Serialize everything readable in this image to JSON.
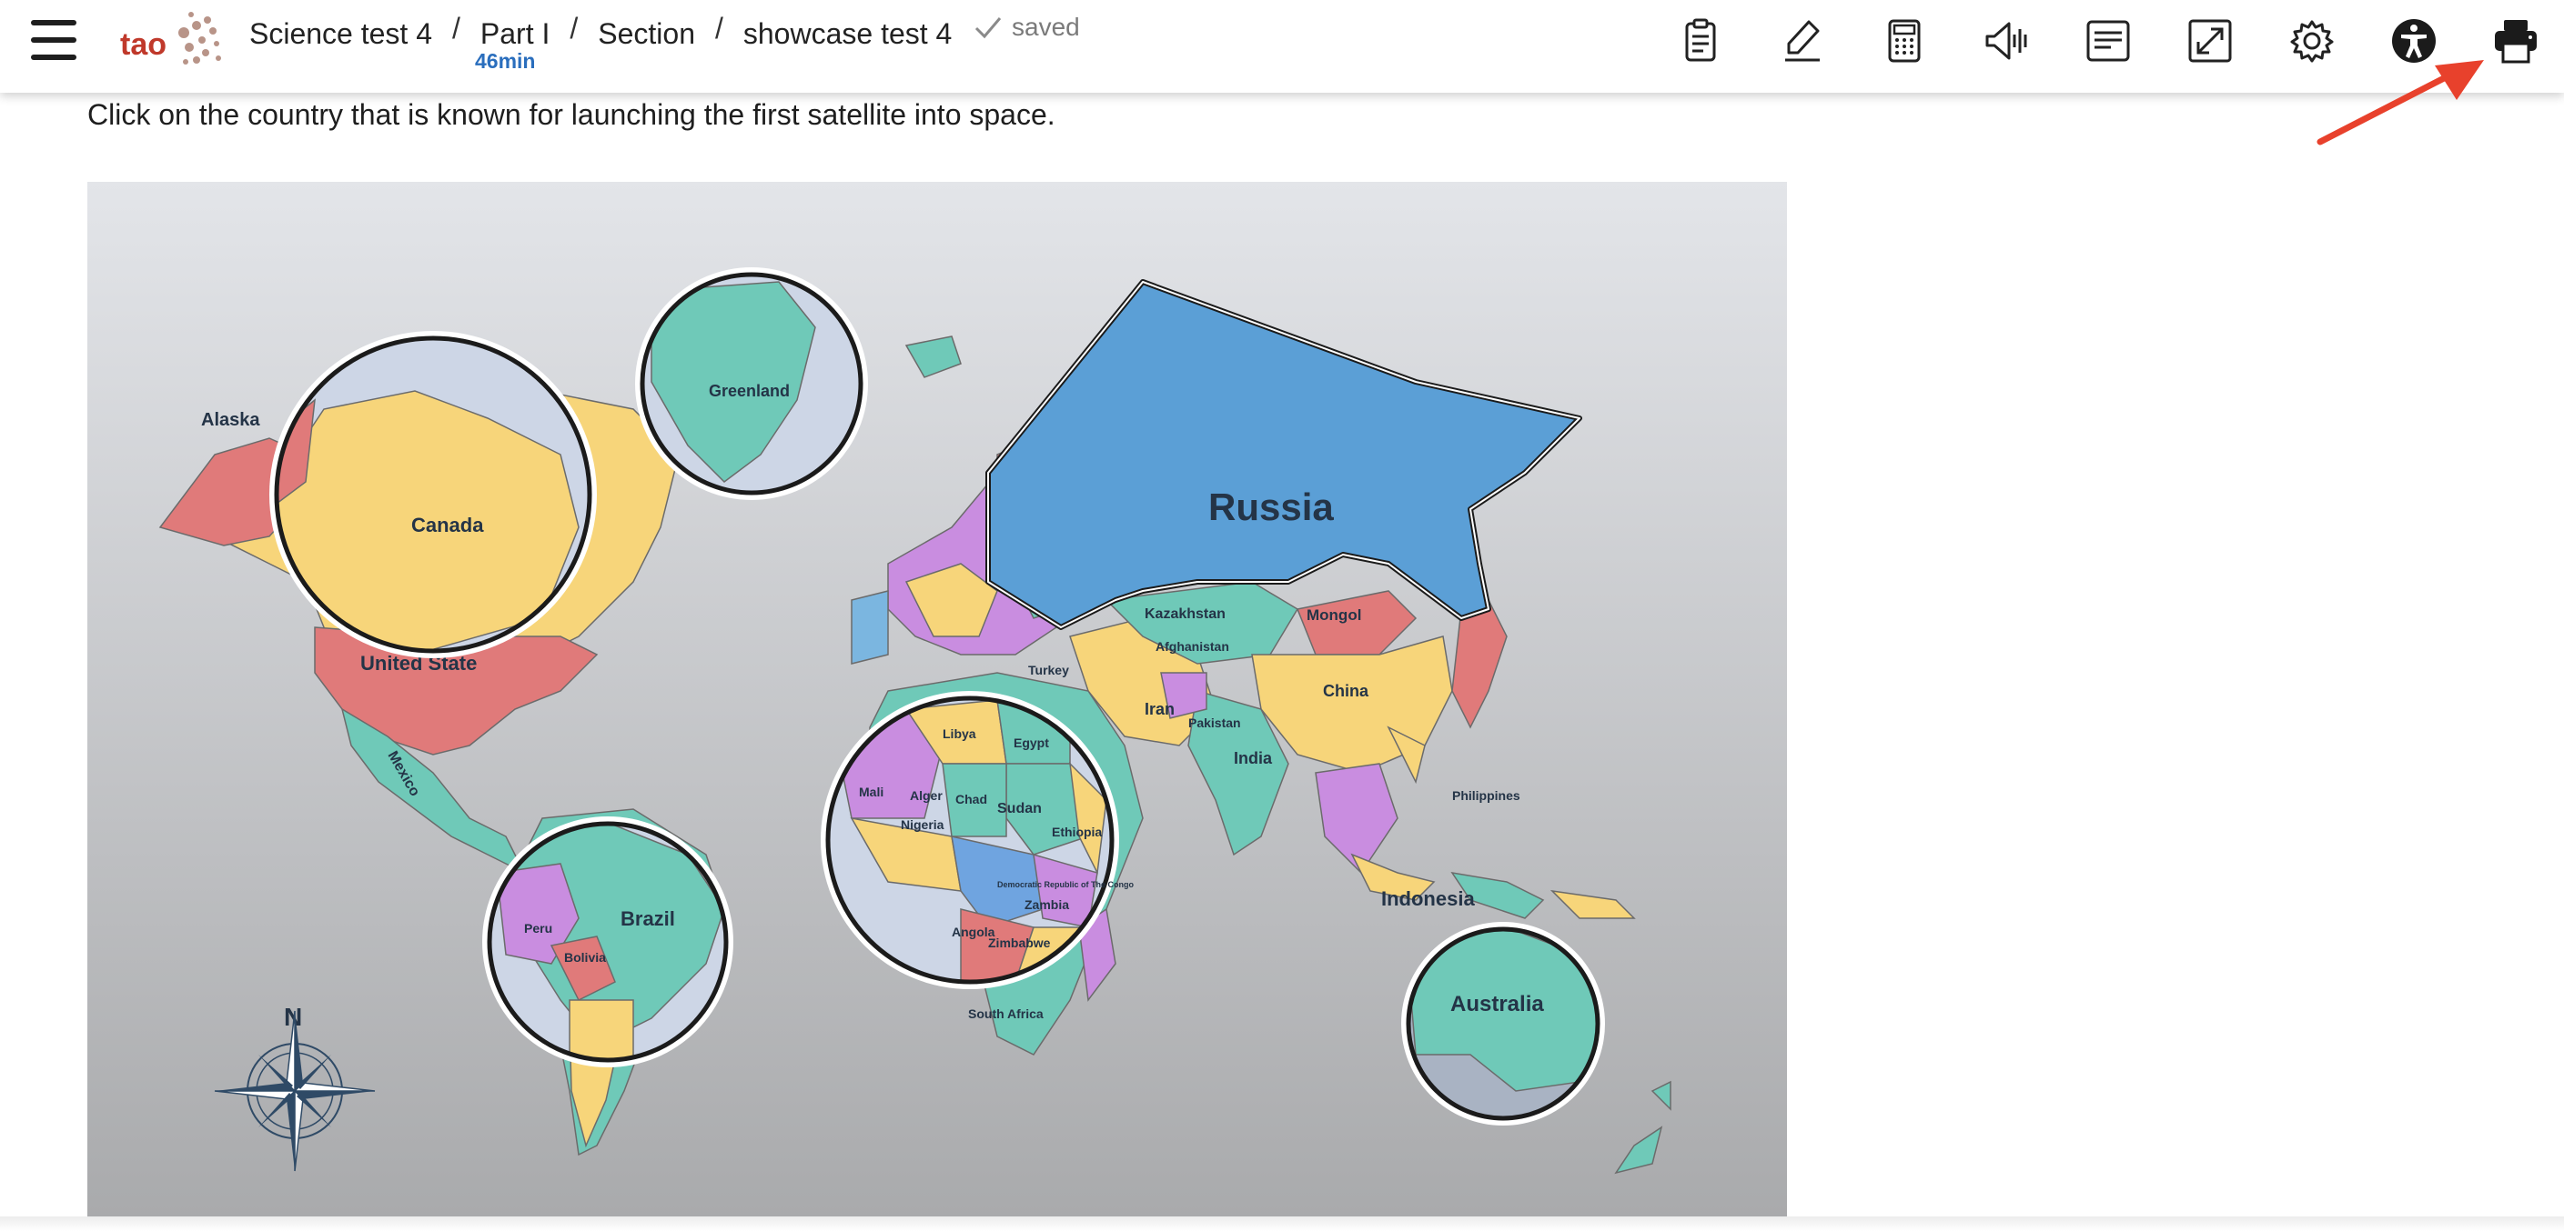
{
  "app": {
    "logo_text": "tao"
  },
  "breadcrumb": {
    "items": [
      "Science test 4",
      "Part I",
      "Section",
      "showcase test 4"
    ],
    "separator": "/"
  },
  "timer": "46min",
  "status": {
    "saved": "saved"
  },
  "toolbar": {
    "tools": [
      {
        "name": "notepad-icon"
      },
      {
        "name": "highlighter-icon"
      },
      {
        "name": "calculator-icon"
      },
      {
        "name": "text-to-speech-icon"
      },
      {
        "name": "line-reader-icon"
      },
      {
        "name": "fullscreen-icon"
      },
      {
        "name": "settings-gear-icon"
      },
      {
        "name": "accessibility-icon"
      },
      {
        "name": "print-icon"
      }
    ]
  },
  "question": {
    "prompt": "Click on the country that is known for launching the first satellite into space."
  },
  "map": {
    "labels": {
      "russia": "Russia",
      "canada": "Canada",
      "alaska": "Alaska",
      "greenland": "Greenland",
      "united_states": "United State",
      "mexico": "Mexico",
      "brazil": "Brazil",
      "peru": "Peru",
      "bolivia": "Bolivia",
      "kazakhstan": "Kazakhstan",
      "mongol": "Mongol",
      "china": "China",
      "iran": "Iran",
      "india": "India",
      "indonesia": "Indonesia",
      "australia": "Australia",
      "sudan": "Sudan",
      "libya": "Libya",
      "egypt": "Egypt",
      "ethiopia": "Ethiopia",
      "nigeria": "Nigeria",
      "angola": "Angola",
      "zambia": "Zambia",
      "mali": "Mali",
      "algeria": "Alger",
      "chad": "Chad",
      "south_africa": "South Africa",
      "philippines": "Philippines",
      "drc": "Democratic Republic of The Congo",
      "turkey": "Turkey",
      "afghanistan": "Afghanistan",
      "pakistan": "Pakistan",
      "zimbabwe": "Zimbabwe",
      "compass_north": "N"
    }
  },
  "colors": {
    "accent": "#2a6ebd",
    "arrow": "#e8412c",
    "russia": "#5b9fd6",
    "map_bg_top": "#e3e5e9",
    "map_bg_bottom": "#a9aaac"
  }
}
